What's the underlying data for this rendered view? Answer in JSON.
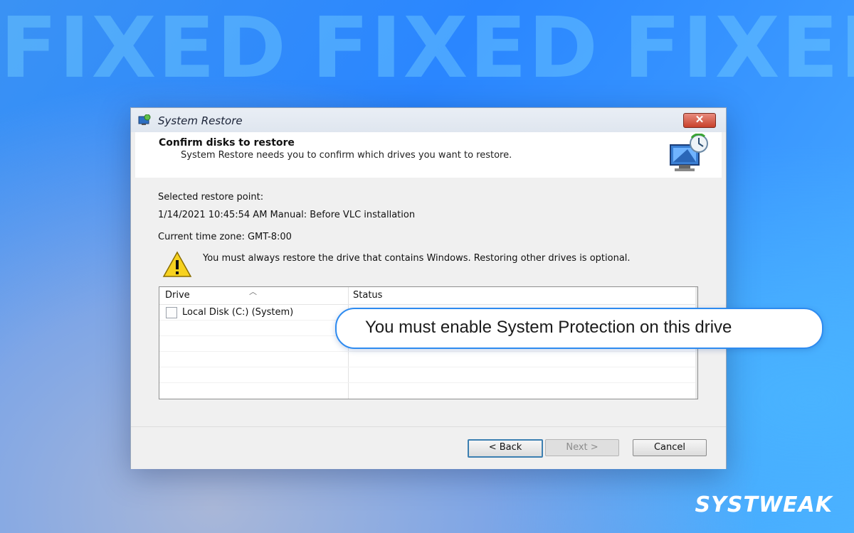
{
  "banner": {
    "words": [
      "FIXED",
      "FIXED",
      "FIXED"
    ]
  },
  "window": {
    "title": "System Restore",
    "close_symbol": "✕",
    "header_title": "Confirm disks to restore",
    "header_subtitle": "System Restore needs you to confirm which drives you want to restore.",
    "selected_label": "Selected restore point:",
    "restore_point": "1/14/2021 10:45:54 AM Manual: Before VLC installation",
    "timezone": "Current time zone: GMT-8:00",
    "warning": "You must always restore the drive that contains Windows. Restoring other drives is optional.",
    "table": {
      "columns": [
        "Drive",
        "Status"
      ],
      "rows": [
        {
          "drive": "Local Disk (C:) (System)",
          "status": ""
        }
      ]
    },
    "buttons": {
      "back": "< Back",
      "next": "Next >",
      "cancel": "Cancel"
    }
  },
  "callout": {
    "text": "You must enable System Protection on this drive"
  },
  "logo": {
    "text": "SYSTWEAK"
  },
  "colors": {
    "accent": "#2e8bf0",
    "background": "#2a86ff",
    "close": "#c8402b"
  },
  "icons": {
    "title": "system-restore-icon",
    "header": "restore-computer-icon",
    "warning": "warning-icon"
  }
}
